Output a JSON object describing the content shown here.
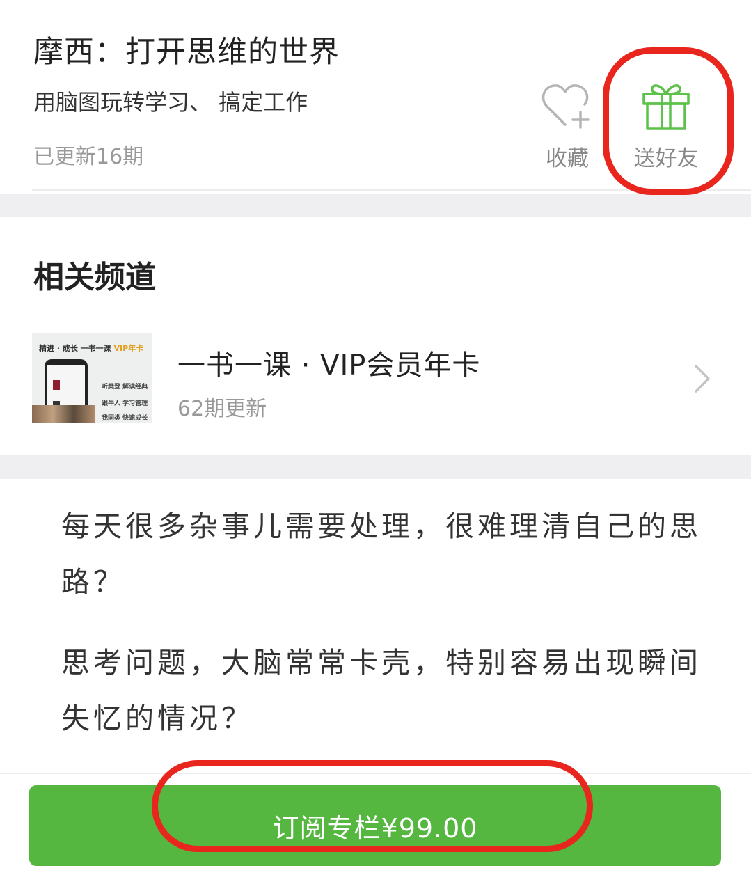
{
  "column": {
    "title": "摩西：打开思维的世界",
    "subtitle": "用脑图玩转学习、 搞定工作",
    "updated": "已更新16期"
  },
  "actions": {
    "favorite_label": "收藏",
    "favorite_icon": "heart-plus-icon",
    "gift_label": "送好友",
    "gift_icon": "gift-icon",
    "gift_color": "#5cc24a"
  },
  "related": {
    "section_title": "相关频道",
    "channel": {
      "name": "一书一课 · VIP会员年卡",
      "updates": "62期更新",
      "thumbnail": {
        "banner_prefix": "精进 · 成长   一书一课 ",
        "banner_vip": "VIP年卡",
        "line1": "听樊登 解读经典",
        "line2": "跟牛人 学习管理",
        "line3": "我同类 快速成长"
      }
    }
  },
  "description": {
    "paragraph1": "每天很多杂事儿需要处理，很难理清自己的思路？",
    "paragraph2": "思考问题，大脑常常卡壳，特别容易出现瞬间失忆的情况？"
  },
  "subscribe": {
    "label": "订阅专栏¥99.00",
    "color": "#55b640"
  },
  "annotation_color": "#e8261e"
}
